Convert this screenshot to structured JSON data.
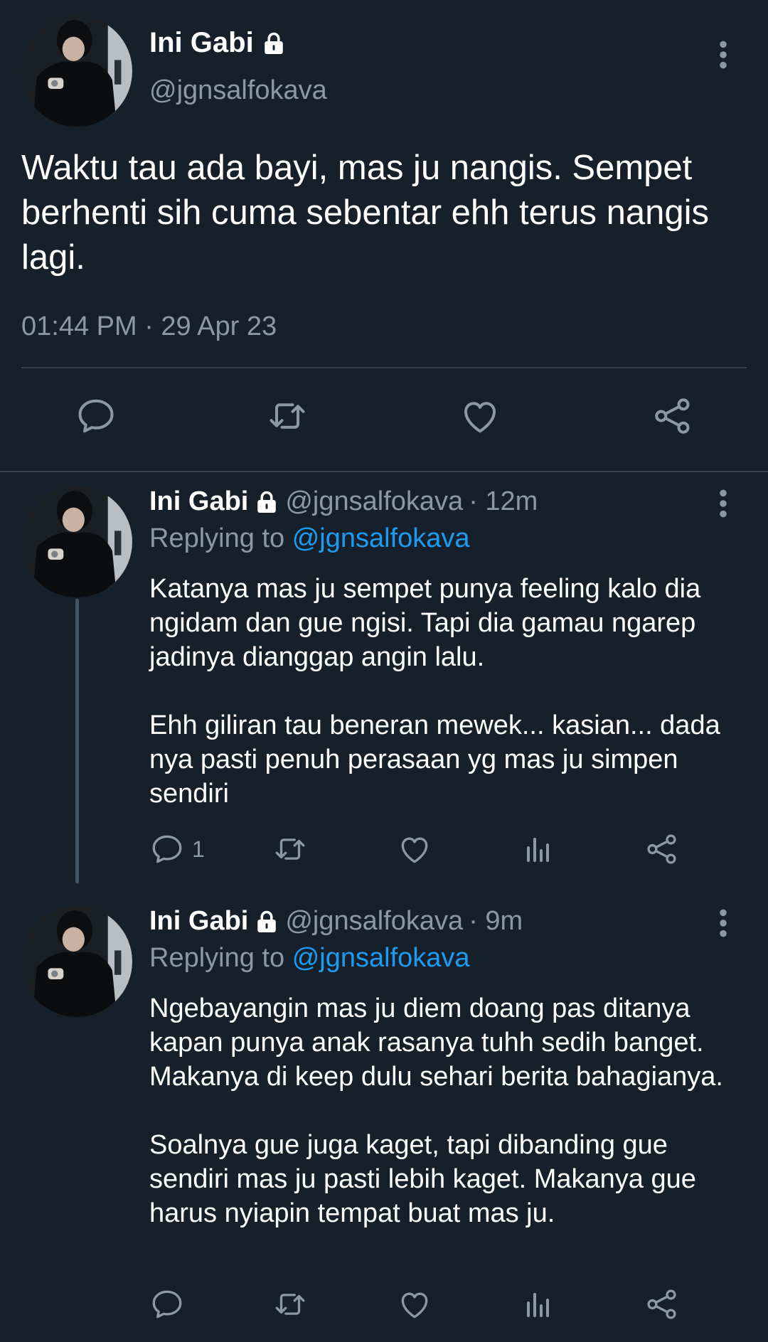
{
  "main_tweet": {
    "display_name": "Ini Gabi",
    "handle": "@jgnsalfokava",
    "text": "Waktu tau ada bayi, mas ju nangis. Sempet berhenti sih cuma sebentar ehh terus nangis lagi.",
    "timestamp": "01:44 PM · 29 Apr 23",
    "icons": [
      "reply-icon",
      "retweet-icon",
      "like-icon",
      "share-icon"
    ]
  },
  "replies": [
    {
      "display_name": "Ini Gabi",
      "handle": "@jgnsalfokava",
      "age": "· 12m",
      "replying_prefix": "Replying to",
      "replying_to": "@jgnsalfokava",
      "text": "Katanya mas ju sempet punya feeling kalo dia ngidam dan gue ngisi. Tapi dia gamau ngarep jadinya dianggap angin lalu.\n\nEhh giliran tau beneran mewek... kasian... dada nya pasti penuh perasaan yg mas ju simpen sendiri",
      "reply_count": "1"
    },
    {
      "display_name": "Ini Gabi",
      "handle": "@jgnsalfokava",
      "age": "· 9m",
      "replying_prefix": "Replying to",
      "replying_to": "@jgnsalfokava",
      "text": "Ngebayangin mas ju diem doang pas ditanya kapan punya anak rasanya tuhh sedih banget. Makanya di keep dulu sehari berita bahagianya.\n\nSoalnya gue juga kaget, tapi dibanding gue sendiri mas ju pasti lebih kaget. Makanya gue harus nyiapin tempat buat mas ju.",
      "reply_count": ""
    }
  ],
  "colors": {
    "background": "#15202b",
    "text": "#ffffff",
    "muted": "#8b98a5",
    "link": "#1d9bf0",
    "divider": "#38444d"
  }
}
